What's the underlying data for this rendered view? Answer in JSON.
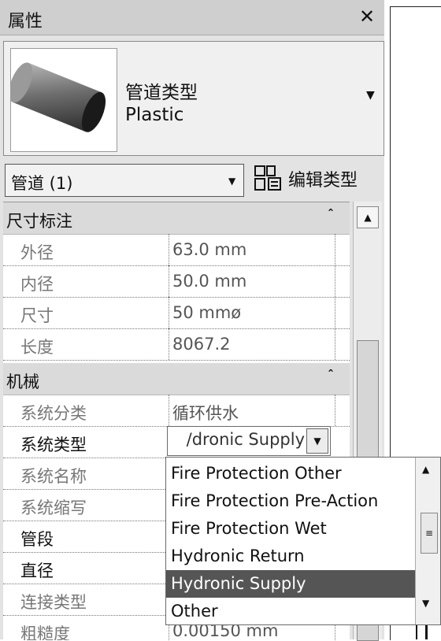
{
  "window": {
    "title": "属性",
    "close_glyph": "✕"
  },
  "type_selector": {
    "family": "管道类型",
    "type_name": "Plastic",
    "arrow_glyph": "▼",
    "thumb_icon": "pipe-3d-icon"
  },
  "instance_filter": {
    "label": "管道 (1)",
    "arrow_glyph": "▼"
  },
  "edit_type": {
    "label": "编辑类型",
    "icon": "edit-type-icon"
  },
  "groups": {
    "dimensions": {
      "label": "尺寸标注",
      "chevron": "⌃⌃",
      "rows": [
        {
          "name": "外径",
          "value": "63.0 mm"
        },
        {
          "name": "内径",
          "value": "50.0 mm"
        },
        {
          "name": "尺寸",
          "value": "50 mmø"
        },
        {
          "name": "长度",
          "value": "8067.2"
        }
      ]
    },
    "mechanical": {
      "label": "机械",
      "chevron": "⌃⌃",
      "rows": [
        {
          "name": "系统分类",
          "value": "循环供水"
        },
        {
          "name": "系统类型",
          "value": "Hydronic Supply"
        },
        {
          "name": "系统名称",
          "value": ""
        },
        {
          "name": "系统缩写",
          "value": ""
        },
        {
          "name": "管段",
          "value": ""
        },
        {
          "name": "直径",
          "value": ""
        },
        {
          "name": "连接类型",
          "value": ""
        },
        {
          "name": "粗糙度",
          "value": "0.00150 mm"
        }
      ]
    }
  },
  "system_type_value_visible": "/dronic Supply",
  "dropdown": {
    "options": [
      "Fire Protection Other",
      "Fire Protection Pre-Action",
      "Fire Protection Wet",
      "Hydronic Return",
      "Hydronic Supply",
      "Other"
    ],
    "selected": "Hydronic Supply",
    "scroll_up": "▲",
    "scroll_thumb": "≡",
    "scroll_down": "▼"
  },
  "scrollbar": {
    "up_glyph": "▲"
  },
  "colors": {
    "panel_bg": "#e3e3e3",
    "header_bg": "#dadada",
    "selected_option_bg": "#555555"
  }
}
